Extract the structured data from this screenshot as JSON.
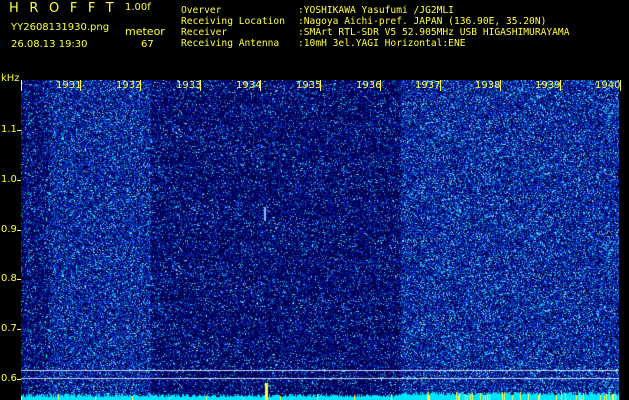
{
  "header": {
    "title": "HROFFT",
    "version": "1.00f",
    "filename": "YY2608131930.png",
    "mode": "meteor",
    "datetime": "26.08.13 19:30",
    "count": "67"
  },
  "info": [
    {
      "label": "Overver",
      "value": ":YOSHIKAWA Yasufumi /JG2MLI"
    },
    {
      "label": "Receiving Location",
      "value": ":Nagoya Aichi-pref. JAPAN (136.90E, 35.20N)"
    },
    {
      "label": "Receiver",
      "value": ":SMArt RTL-SDR V5 52.905MHz USB HIGASHIMURAYAMA"
    },
    {
      "label": "Receiving Antenna",
      "value": ":10mH 3el.YAGI Horizontal:ENE"
    }
  ],
  "waterfall": {
    "y_unit": "kHz",
    "y_labels": [
      "1.1",
      "1.0",
      "0.9",
      "0.8",
      "0.7",
      "0.6"
    ],
    "x_labels": [
      "1931",
      "1932",
      "1933",
      "1934",
      "1935",
      "1936",
      "1937",
      "1938",
      "1939",
      "1940"
    ],
    "colors": {
      "background": "#000055",
      "noise_low": "#0a1a9a",
      "noise_high": "#4bd6ff",
      "accent": "#ffff40",
      "baseline": "#00e5ff"
    }
  }
}
